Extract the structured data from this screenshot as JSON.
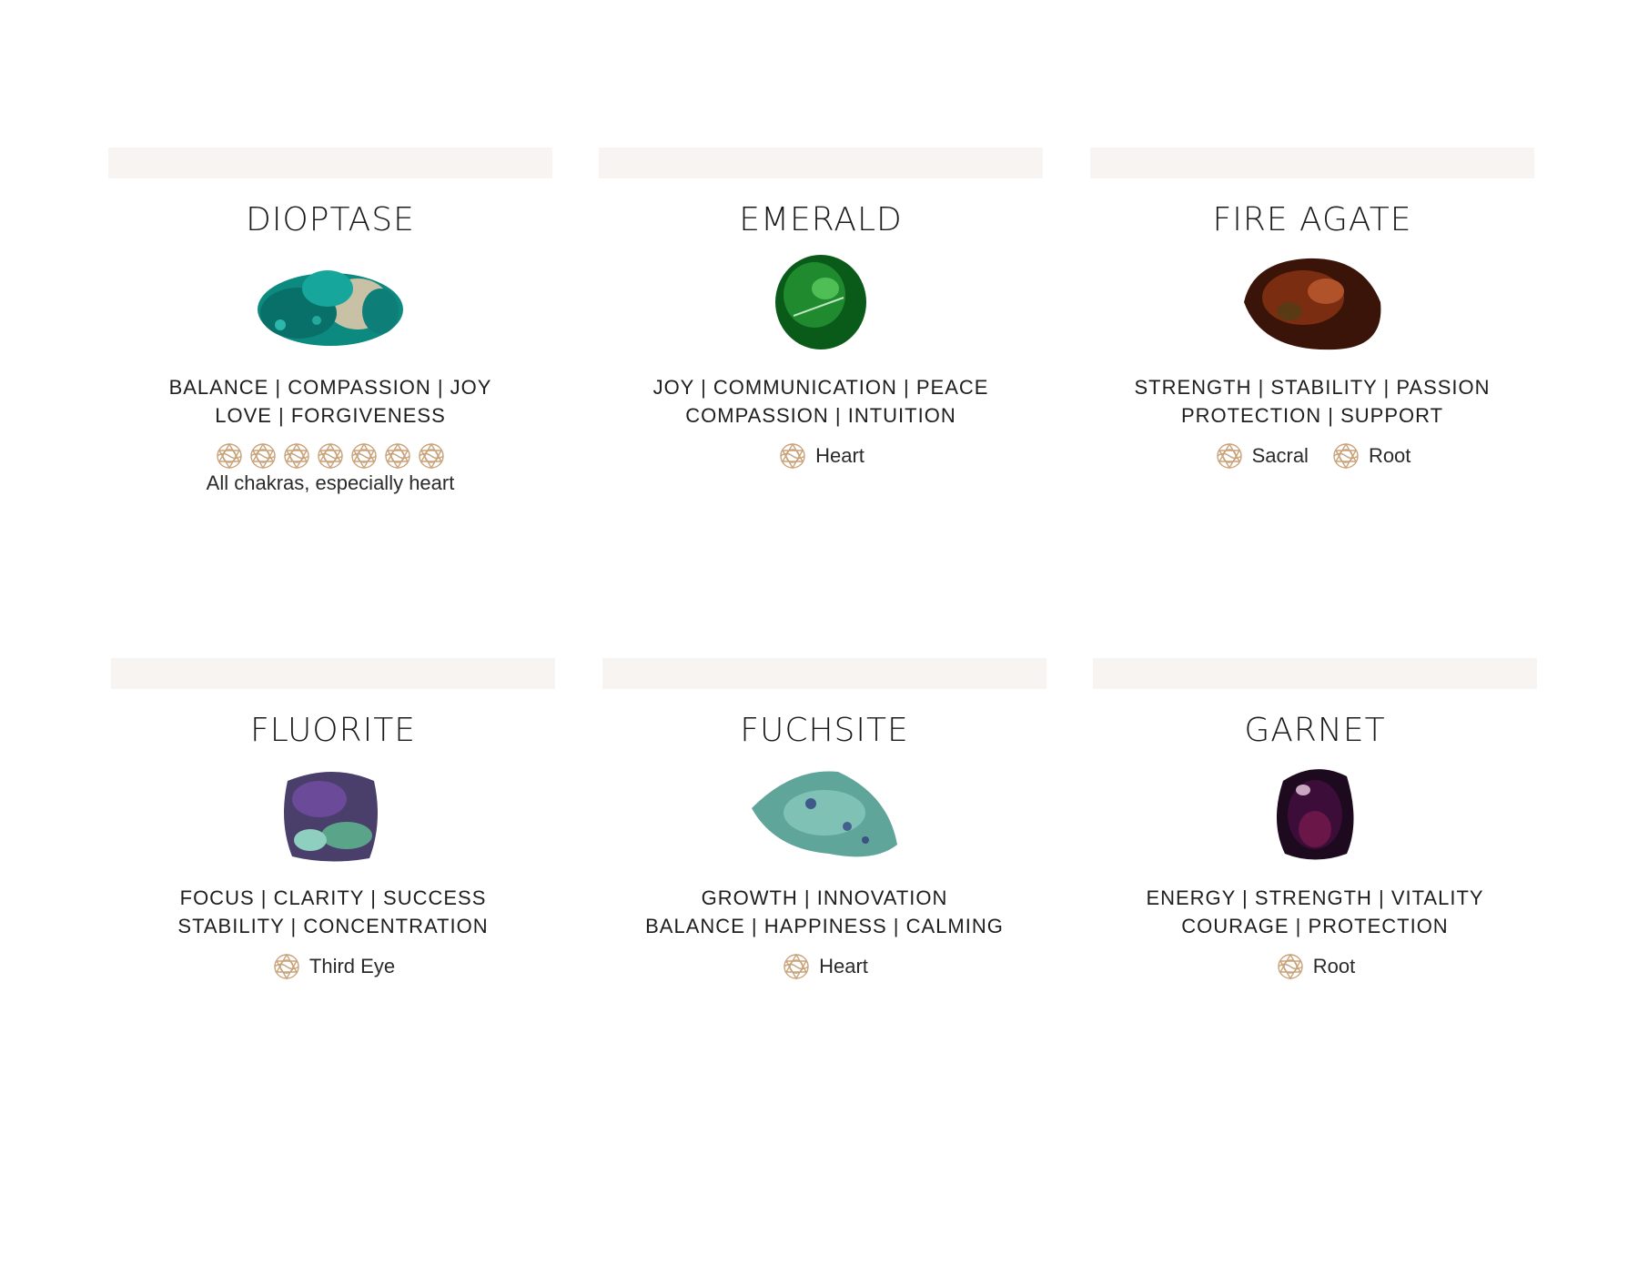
{
  "cards": [
    {
      "name": "DIOPTASE",
      "props_line1": "BALANCE | COMPASSION | JOY",
      "props_line2": "LOVE | FORGIVENESS",
      "note": "All chakras, especially heart"
    },
    {
      "name": "EMERALD",
      "props_line1": "JOY | COMMUNICATION | PEACE",
      "props_line2": "COMPASSION | INTUITION",
      "chakras": [
        "Heart"
      ]
    },
    {
      "name": "FIRE AGATE",
      "props_line1": "STRENGTH | STABILITY | PASSION",
      "props_line2": "PROTECTION | SUPPORT",
      "chakras": [
        "Sacral",
        "Root"
      ]
    },
    {
      "name": "FLUORITE",
      "props_line1": "FOCUS | CLARITY | SUCCESS",
      "props_line2": "STABILITY | CONCENTRATION",
      "chakras": [
        "Third Eye"
      ]
    },
    {
      "name": "FUCHSITE",
      "props_line1": "GROWTH | INNOVATION",
      "props_line2": "BALANCE | HAPPINESS | CALMING",
      "chakras": [
        "Heart"
      ]
    },
    {
      "name": "GARNET",
      "props_line1": "ENERGY | STRENGTH | VITALITY",
      "props_line2": "COURAGE | PROTECTION",
      "chakras": [
        "Root"
      ]
    }
  ],
  "colors": {
    "band": "#f7f4f2",
    "chakra_gold": "#c9a37a"
  },
  "icons": {
    "chakra": "chakra-symbol-icon"
  }
}
